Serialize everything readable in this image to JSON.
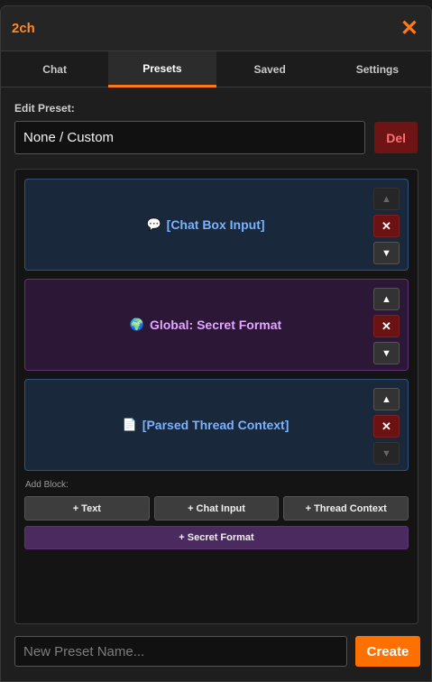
{
  "header": {
    "title": "2ch",
    "close_glyph": "✕"
  },
  "tabs": [
    {
      "label": "Chat",
      "active": false
    },
    {
      "label": "Presets",
      "active": true
    },
    {
      "label": "Saved",
      "active": false
    },
    {
      "label": "Settings",
      "active": false
    }
  ],
  "edit_preset": {
    "label": "Edit Preset:",
    "selected": "None / Custom",
    "delete_label": "Del"
  },
  "blocks": [
    {
      "icon": "speech-bubble-icon",
      "glyph": "💬",
      "label": "[Chat Box Input]",
      "style": "blue",
      "up_disabled": true,
      "down_disabled": false
    },
    {
      "icon": "globe-icon",
      "glyph": "🌍",
      "label": "Global: Secret Format",
      "style": "purple",
      "up_disabled": false,
      "down_disabled": false
    },
    {
      "icon": "document-icon",
      "glyph": "📄",
      "label": "[Parsed Thread Context]",
      "style": "blue",
      "up_disabled": false,
      "down_disabled": true
    }
  ],
  "add_block": {
    "label": "Add Block:",
    "buttons": [
      "+ Text",
      "+ Chat Input",
      "+ Thread Context"
    ],
    "secret_button": "+ Secret Format"
  },
  "new_preset": {
    "placeholder": "New Preset Name...",
    "value": "",
    "create_label": "Create"
  },
  "colors": {
    "accent": "#ff7000",
    "danger": "#6e1414",
    "block_blue": "#19283a",
    "block_purple": "#2c1836"
  }
}
